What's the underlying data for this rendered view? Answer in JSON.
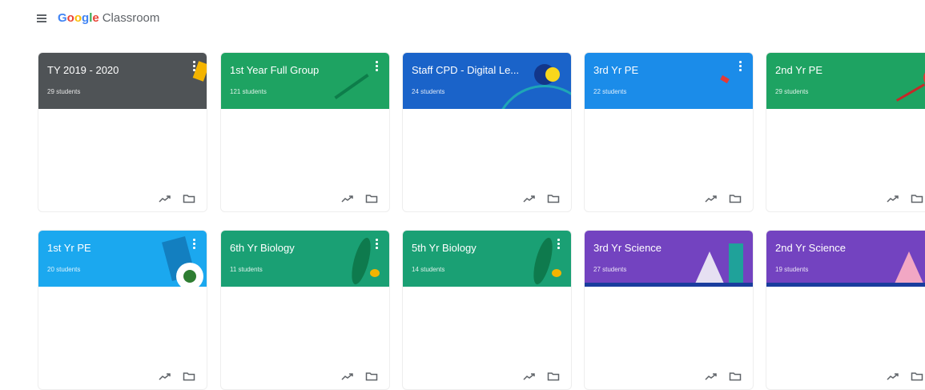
{
  "app": {
    "logo_parts": [
      "G",
      "o",
      "o",
      "g",
      "l",
      "e"
    ],
    "classroom_label": "Classroom"
  },
  "colors": {
    "grey": "#4f5356",
    "green": "#1ea362",
    "blue_dark": "#1a63c9",
    "blue": "#1b8ce9",
    "blue_light": "#1ba8ef",
    "green2": "#1aa074",
    "purple": "#7343c0"
  },
  "classes": [
    {
      "title": "TY 2019 - 2020",
      "subtitle": "29 students",
      "color": "#4f5356"
    },
    {
      "title": "1st Year Full Group",
      "subtitle": "121 students",
      "color": "#1ea362"
    },
    {
      "title": "Staff CPD - Digital Le...",
      "subtitle": "24 students",
      "color": "#1a63c9"
    },
    {
      "title": "3rd Yr PE",
      "subtitle": "22 students",
      "color": "#1b8ce9"
    },
    {
      "title": "2nd Yr PE",
      "subtitle": "29 students",
      "color": "#1ea362"
    },
    {
      "title": "1st Yr PE",
      "subtitle": "20 students",
      "color": "#1ba8ef"
    },
    {
      "title": "6th Yr Biology",
      "subtitle": "11 students",
      "color": "#1aa074"
    },
    {
      "title": "5th Yr Biology",
      "subtitle": "14 students",
      "color": "#1aa074"
    },
    {
      "title": "3rd Yr Science",
      "subtitle": "27 students",
      "color": "#7343c0"
    },
    {
      "title": "2nd Yr Science",
      "subtitle": "19 students",
      "color": "#7343c0"
    }
  ],
  "icons": {
    "menu": "hamburger-icon",
    "more": "more-vert-icon",
    "gradebook": "trending-up-icon",
    "folder": "folder-icon"
  }
}
